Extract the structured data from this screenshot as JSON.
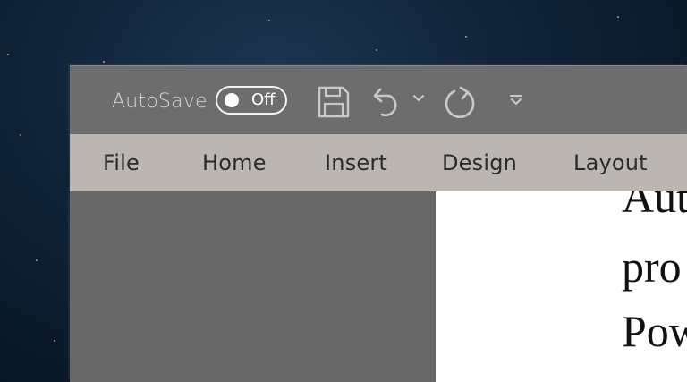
{
  "titlebar": {
    "autosave_label": "AutoSave",
    "autosave_toggle": {
      "state_label": "Off"
    },
    "quick_access": [
      {
        "name": "save-icon"
      },
      {
        "name": "undo-icon"
      },
      {
        "name": "undo-dropdown-icon"
      },
      {
        "name": "redo-icon"
      },
      {
        "name": "customize-toolbar-icon"
      }
    ]
  },
  "ribbon": {
    "tabs": [
      {
        "label": "File"
      },
      {
        "label": "Home"
      },
      {
        "label": "Insert"
      },
      {
        "label": "Design"
      },
      {
        "label": "Layout"
      }
    ]
  },
  "document": {
    "lines": [
      "Aut",
      "pro",
      "Pow"
    ]
  },
  "colors": {
    "titlebar_bg": "#6d6d6d",
    "ribbon_bg": "#bcb6b2",
    "pane_bg": "#686868",
    "page_bg": "#ffffff",
    "toggle_fg": "#ffffff"
  }
}
